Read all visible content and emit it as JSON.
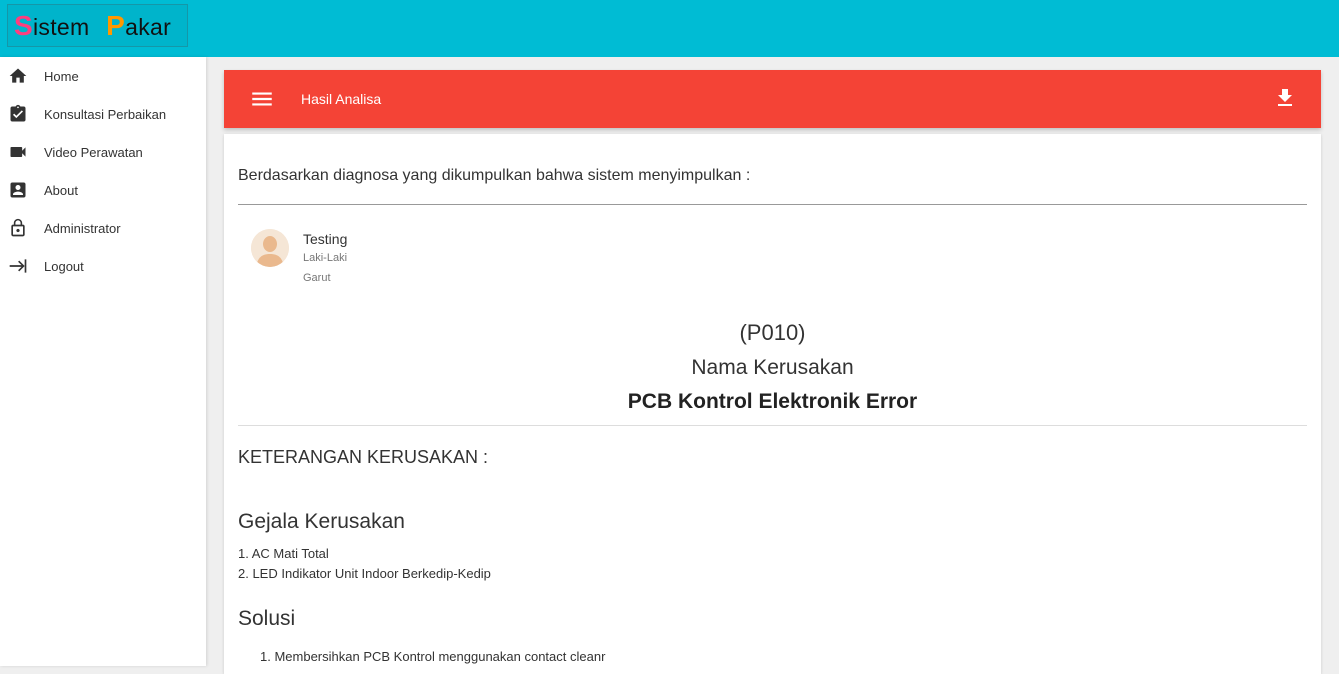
{
  "app": {
    "logo_letter_s": "S",
    "logo_word_1": "istem",
    "logo_letter_p": "P",
    "logo_word_2": "akar"
  },
  "sidebar": {
    "items": [
      {
        "label": "Home",
        "icon": "home-icon"
      },
      {
        "label": "Konsultasi Perbaikan",
        "icon": "clipboard-check-icon"
      },
      {
        "label": "Video Perawatan",
        "icon": "video-camera-icon"
      },
      {
        "label": "About",
        "icon": "account-box-icon"
      },
      {
        "label": "Administrator",
        "icon": "lock-icon"
      },
      {
        "label": "Logout",
        "icon": "logout-arrow-icon"
      }
    ]
  },
  "header": {
    "title": "Hasil Analisa",
    "menu_icon": "menu-icon",
    "download_icon": "download-icon"
  },
  "result": {
    "intro": "Berdasarkan diagnosa yang dikumpulkan bahwa sistem menyimpulkan :",
    "user": {
      "name": "Testing",
      "gender": "Laki-Laki",
      "city": "Garut"
    },
    "code": "(P010)",
    "nama_label": "Nama Kerusakan",
    "nama_value": "PCB Kontrol Elektronik Error",
    "keterangan": "KETERANGAN KERUSAKAN :",
    "gejala_title": "Gejala Kerusakan",
    "gejala": [
      "1. AC Mati Total",
      "2. LED Indikator Unit Indoor Berkedip-Kedip"
    ],
    "solusi_title": "Solusi",
    "solusi": [
      "1. Membersihkan PCB Kontrol menggunakan contact cleanr"
    ]
  },
  "colors": {
    "topbar": "#00bcd4",
    "header": "#f44336",
    "background": "#efefef"
  }
}
